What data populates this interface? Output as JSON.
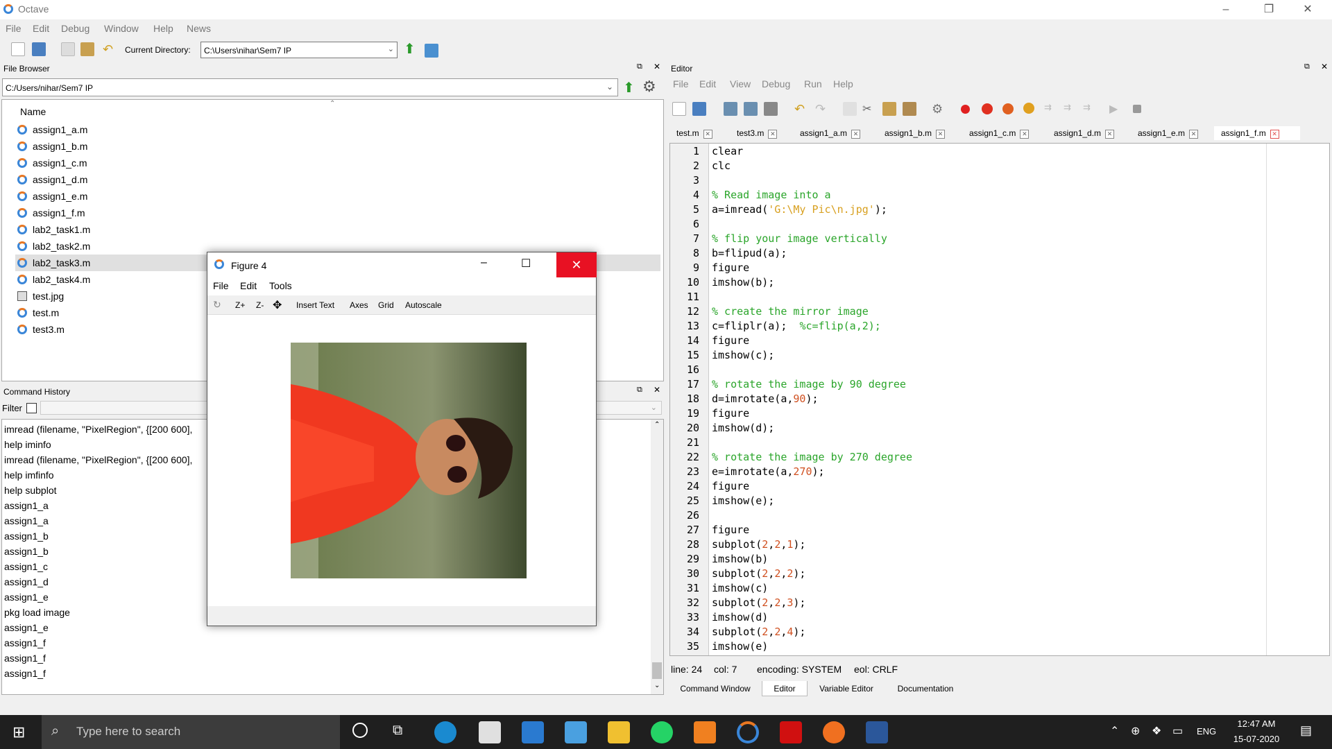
{
  "app": {
    "title": "Octave",
    "menu": [
      "File",
      "Edit",
      "Debug",
      "Window",
      "Help",
      "News"
    ]
  },
  "toolbar": {
    "current_dir_label": "Current Directory:",
    "current_dir": "C:\\Users\\nihar\\Sem7 IP"
  },
  "file_browser": {
    "title": "File Browser",
    "path": "C:/Users/nihar/Sem7 IP",
    "column": "Name",
    "files": [
      "assign1_a.m",
      "assign1_b.m",
      "assign1_c.m",
      "assign1_d.m",
      "assign1_e.m",
      "assign1_f.m",
      "lab2_task1.m",
      "lab2_task2.m",
      "lab2_task3.m",
      "lab2_task4.m",
      "test.jpg",
      "test.m",
      "test3.m"
    ],
    "selected": "lab2_task3.m"
  },
  "history": {
    "title": "Command History",
    "filter_label": "Filter",
    "items": [
      "imread (filename, \"PixelRegion\", {[200 600],",
      "help iminfo",
      "imread (filename, \"PixelRegion\", {[200 600],",
      "help imfinfo",
      "help subplot",
      "assign1_a",
      "assign1_a",
      "assign1_b",
      "assign1_b",
      "assign1_c",
      "assign1_d",
      "assign1_e",
      "pkg load image",
      "assign1_e",
      "assign1_f",
      "assign1_f",
      "assign1_f"
    ]
  },
  "figure": {
    "title": "Figure 4",
    "menu": [
      "File",
      "Edit",
      "Tools"
    ],
    "tools": [
      "Z+",
      "Z-",
      "Insert Text",
      "Axes",
      "Grid",
      "Autoscale"
    ]
  },
  "editor": {
    "title": "Editor",
    "menu": [
      "File",
      "Edit",
      "View",
      "Debug",
      "Run",
      "Help"
    ],
    "tabs": [
      "test.m",
      "test3.m",
      "assign1_a.m",
      "assign1_b.m",
      "assign1_c.m",
      "assign1_d.m",
      "assign1_e.m",
      "assign1_f.m"
    ],
    "active_tab": "assign1_f.m",
    "line_numbers": [
      "1",
      "2",
      "3",
      "4",
      "5",
      "6",
      "7",
      "8",
      "9",
      "10",
      "11",
      "12",
      "13",
      "14",
      "15",
      "16",
      "17",
      "18",
      "19",
      "20",
      "21",
      "22",
      "23",
      "24",
      "25",
      "26",
      "27",
      "28",
      "29",
      "30",
      "31",
      "32",
      "33",
      "34",
      "35"
    ],
    "status": {
      "line": "line: 24",
      "col": "col: 7",
      "encoding": "encoding: SYSTEM",
      "eol": "eol: CRLF"
    }
  },
  "bottom_tabs": [
    "Command Window",
    "Editor",
    "Variable Editor",
    "Documentation"
  ],
  "taskbar": {
    "search": "Type here to search",
    "lang": "ENG",
    "time": "12:47 AM",
    "date": "15-07-2020"
  },
  "colors": {
    "comment": "#2aa52a",
    "string": "#d8a020",
    "number": "#d05020",
    "close_red": "#e81123"
  }
}
